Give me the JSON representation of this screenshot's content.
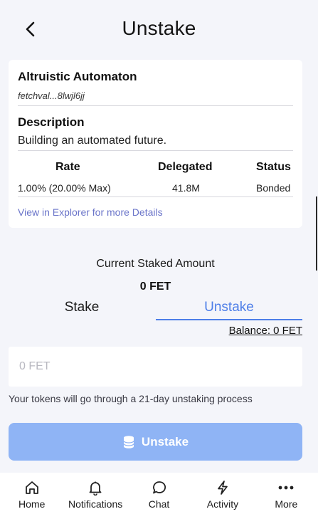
{
  "header": {
    "title": "Unstake"
  },
  "validator": {
    "name": "Altruistic Automaton",
    "address": "fetchval...8lwjl6jj",
    "description_label": "Description",
    "description": "Building an automated future.",
    "table": {
      "headers": [
        "Rate",
        "Delegated",
        "Status"
      ],
      "rate": "1.00% (20.00% Max)",
      "delegated": "41.8M",
      "status": "Bonded"
    },
    "explorer_link": "View in Explorer for more Details"
  },
  "staked": {
    "label": "Current Staked Amount",
    "value": "0 FET"
  },
  "tabs": [
    "Stake",
    "Unstake"
  ],
  "active_tab": "Unstake",
  "balance": "Balance: 0 FET",
  "amount_input": {
    "placeholder": "0 FET",
    "value": ""
  },
  "note": "Your tokens will go through a 21-day unstaking process",
  "action_button": {
    "label": "Unstake",
    "icon": "coins-icon"
  },
  "bottom_nav": [
    {
      "label": "Home",
      "icon": "home-icon"
    },
    {
      "label": "Notifications",
      "icon": "bell-icon"
    },
    {
      "label": "Chat",
      "icon": "chat-icon"
    },
    {
      "label": "Activity",
      "icon": "lightning-icon"
    },
    {
      "label": "More",
      "icon": "more-icon"
    }
  ],
  "colors": {
    "accent": "#4d7ee8",
    "button_disabled": "#8fb4f5",
    "link": "#6a74c9",
    "background": "#f4f5fa"
  }
}
